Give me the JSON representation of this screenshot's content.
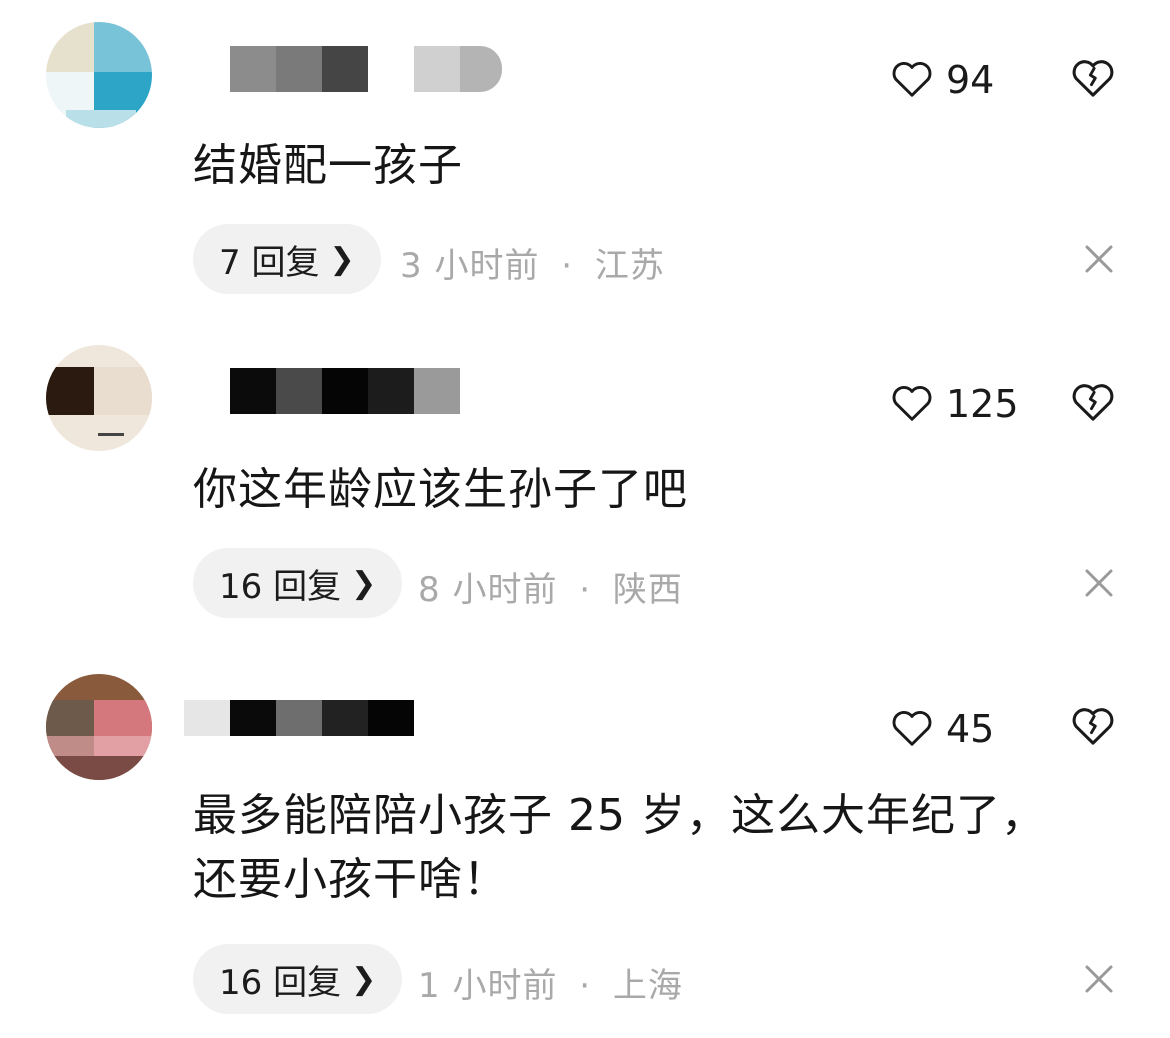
{
  "comments": [
    {
      "like_count": "94",
      "text_lines": [
        "结婚配一孩子"
      ],
      "reply_label": "7 回复",
      "time": "3 小时前",
      "separator": "·",
      "location": "江苏"
    },
    {
      "like_count": "125",
      "text_lines": [
        "你这年龄应该生孙子了吧"
      ],
      "reply_label": "16 回复",
      "time": "8 小时前",
      "separator": "·",
      "location": "陕西"
    },
    {
      "like_count": "45",
      "text_lines": [
        "最多能陪陪小孩子 25 岁，这么大年纪了，",
        "还要小孩干啥！"
      ],
      "reply_label": "16 回复",
      "time": "1 小时前",
      "separator": "·",
      "location": "上海"
    }
  ],
  "icons": {
    "like": "heart-outline-icon",
    "dislike": "broken-heart-icon",
    "close": "close-icon",
    "reply_chevron": "chevron-right-icon"
  },
  "colors": {
    "text": "#161616",
    "meta": "#a9a9a9",
    "pill_bg": "#f1f1f1"
  }
}
